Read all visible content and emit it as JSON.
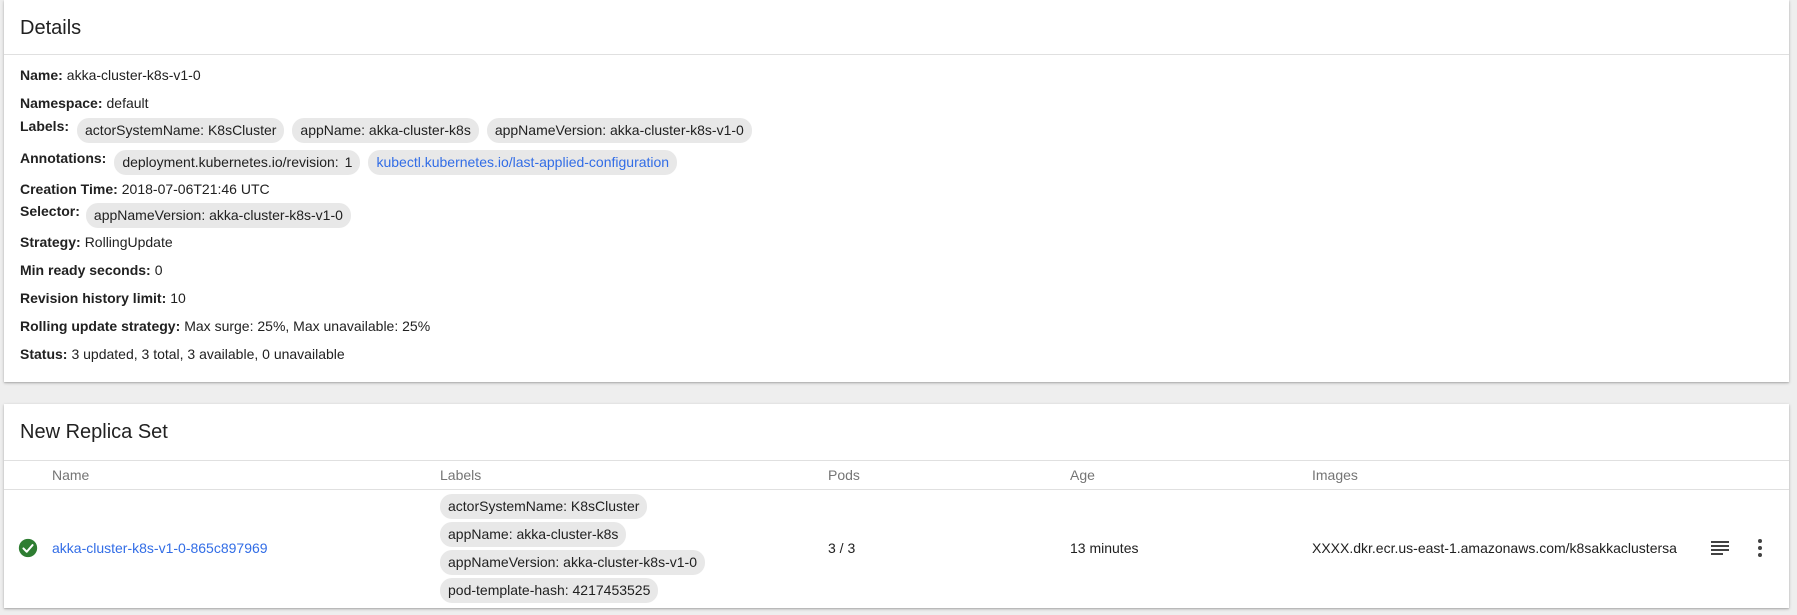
{
  "details": {
    "title": "Details",
    "name": {
      "key": "Name:",
      "value": "akka-cluster-k8s-v1-0"
    },
    "namespace": {
      "key": "Namespace:",
      "value": "default"
    },
    "labels": {
      "key": "Labels:",
      "items": [
        "actorSystemName: K8sCluster",
        "appName: akka-cluster-k8s",
        "appNameVersion: akka-cluster-k8s-v1-0"
      ]
    },
    "annotations": {
      "key": "Annotations:",
      "revision_key": "deployment.kubernetes.io/revision:",
      "revision_value": "1",
      "link": "kubectl.kubernetes.io/last-applied-configuration"
    },
    "creation_time": {
      "key": "Creation Time:",
      "value": "2018-07-06T21:46 UTC"
    },
    "selector": {
      "key": "Selector:",
      "items": [
        "appNameVersion: akka-cluster-k8s-v1-0"
      ]
    },
    "strategy": {
      "key": "Strategy:",
      "value": "RollingUpdate"
    },
    "min_ready": {
      "key": "Min ready seconds:",
      "value": "0"
    },
    "revision_limit": {
      "key": "Revision history limit:",
      "value": "10"
    },
    "rolling_update": {
      "key": "Rolling update strategy:",
      "value": "Max surge: 25%, Max unavailable: 25%"
    },
    "status": {
      "key": "Status:",
      "value": "3 updated, 3 total, 3 available, 0 unavailable"
    }
  },
  "replica_set": {
    "title": "New Replica Set",
    "columns": {
      "name": "Name",
      "labels": "Labels",
      "pods": "Pods",
      "age": "Age",
      "images": "Images"
    },
    "row": {
      "status_icon": "check-circle-icon",
      "status_color": "#2e7d32",
      "name": "akka-cluster-k8s-v1-0-865c897969",
      "labels": [
        "actorSystemName: K8sCluster",
        "appName: akka-cluster-k8s",
        "appNameVersion: akka-cluster-k8s-v1-0",
        "pod-template-hash: 4217453525"
      ],
      "pods": "3 / 3",
      "age": "13 minutes",
      "image": "XXXX.dkr.ecr.us-east-1.amazonaws.com/k8sakkaclustersa",
      "actions": [
        "logs-icon",
        "more-vert-icon"
      ]
    }
  },
  "colors": {
    "link": "#326de6",
    "chip": "#e8e8e8",
    "success": "#2e7d32"
  }
}
